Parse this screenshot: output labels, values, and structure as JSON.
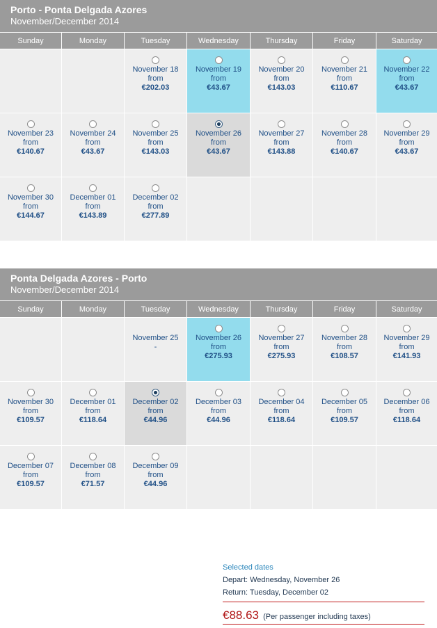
{
  "outbound": {
    "title": "Porto - Ponta Delgada Azores",
    "subtitle": "November/December 2014",
    "days": [
      "Sunday",
      "Monday",
      "Tuesday",
      "Wednesday",
      "Thursday",
      "Friday",
      "Saturday"
    ],
    "weeks": [
      [
        {
          "empty": true
        },
        {
          "empty": true
        },
        {
          "date": "November 18",
          "from": "from",
          "price": "€202.03"
        },
        {
          "date": "November 19",
          "from": "from",
          "price": "€43.67",
          "highlight": "blue"
        },
        {
          "date": "November 20",
          "from": "from",
          "price": "€143.03"
        },
        {
          "date": "November 21",
          "from": "from",
          "price": "€110.67"
        },
        {
          "date": "November 22",
          "from": "from",
          "price": "€43.67",
          "highlight": "blue"
        }
      ],
      [
        {
          "date": "November 23",
          "from": "from",
          "price": "€140.67"
        },
        {
          "date": "November 24",
          "from": "from",
          "price": "€43.67"
        },
        {
          "date": "November 25",
          "from": "from",
          "price": "€143.03"
        },
        {
          "date": "November 26",
          "from": "from",
          "price": "€43.67",
          "highlight": "grey",
          "selected": true
        },
        {
          "date": "November 27",
          "from": "from",
          "price": "€143.88"
        },
        {
          "date": "November 28",
          "from": "from",
          "price": "€140.67"
        },
        {
          "date": "November 29",
          "from": "from",
          "price": "€43.67"
        }
      ],
      [
        {
          "date": "November 30",
          "from": "from",
          "price": "€144.67"
        },
        {
          "date": "December 01",
          "from": "from",
          "price": "€143.89"
        },
        {
          "date": "December 02",
          "from": "from",
          "price": "€277.89"
        },
        {
          "empty": true
        },
        {
          "empty": true
        },
        {
          "empty": true
        },
        {
          "empty": true
        }
      ]
    ]
  },
  "return": {
    "title": "Ponta Delgada Azores - Porto",
    "subtitle": "November/December 2014",
    "days": [
      "Sunday",
      "Monday",
      "Tuesday",
      "Wednesday",
      "Thursday",
      "Friday",
      "Saturday"
    ],
    "weeks": [
      [
        {
          "empty": true
        },
        {
          "empty": true
        },
        {
          "date": "November 25",
          "from": "-",
          "price": "",
          "noradio": true
        },
        {
          "date": "November 26",
          "from": "from",
          "price": "€275.93",
          "highlight": "blue"
        },
        {
          "date": "November 27",
          "from": "from",
          "price": "€275.93"
        },
        {
          "date": "November 28",
          "from": "from",
          "price": "€108.57"
        },
        {
          "date": "November 29",
          "from": "from",
          "price": "€141.93"
        }
      ],
      [
        {
          "date": "November 30",
          "from": "from",
          "price": "€109.57"
        },
        {
          "date": "December 01",
          "from": "from",
          "price": "€118.64"
        },
        {
          "date": "December 02",
          "from": "from",
          "price": "€44.96",
          "highlight": "grey",
          "selected": true
        },
        {
          "date": "December 03",
          "from": "from",
          "price": "€44.96"
        },
        {
          "date": "December 04",
          "from": "from",
          "price": "€118.64"
        },
        {
          "date": "December 05",
          "from": "from",
          "price": "€109.57"
        },
        {
          "date": "December 06",
          "from": "from",
          "price": "€118.64"
        }
      ],
      [
        {
          "date": "December 07",
          "from": "from",
          "price": "€109.57"
        },
        {
          "date": "December 08",
          "from": "from",
          "price": "€71.57"
        },
        {
          "date": "December 09",
          "from": "from",
          "price": "€44.96"
        },
        {
          "empty": true
        },
        {
          "empty": true
        },
        {
          "empty": true
        },
        {
          "empty": true
        }
      ]
    ]
  },
  "summary": {
    "title": "Selected dates",
    "depart": "Depart: Wednesday, November 26",
    "return": "Return: Tuesday, December 02",
    "price": "€88.63",
    "note": "(Per passenger including taxes)"
  },
  "colors": {
    "header_bg": "#9b9b9b",
    "cell_bg": "#eeeeee",
    "highlight_blue": "#93dced",
    "highlight_grey": "#dadada",
    "text_blue": "#1f4f86",
    "price_red": "#b01515"
  }
}
